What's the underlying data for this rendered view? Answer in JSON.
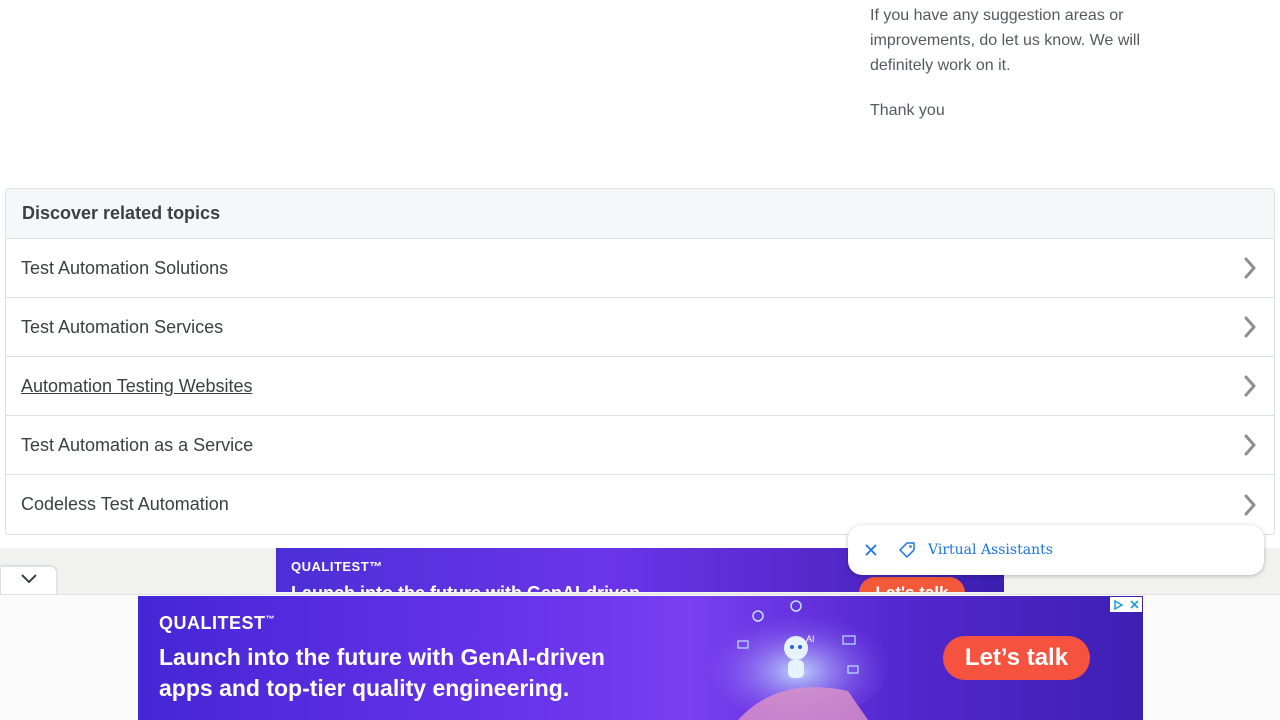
{
  "note": {
    "paragraph": "If you have any suggestion areas or improvements, do let us know. We will definitely work on it.",
    "thanks": "Thank you"
  },
  "related": {
    "title": "Discover related topics",
    "items": [
      {
        "label": "Test Automation Solutions"
      },
      {
        "label": "Test Automation Services"
      },
      {
        "label": "Automation Testing Websites"
      },
      {
        "label": "Test Automation as a Service"
      },
      {
        "label": "Codeless Test Automation"
      }
    ]
  },
  "inline_ad": {
    "brand": "QUALITEST™",
    "headline": "Launch into the future with GenAI-driven",
    "cta": "Let's talk"
  },
  "anchor_ad": {
    "brand": "QUALITEST",
    "brand_mark": "™",
    "line1": "Launch into the future with GenAI-driven",
    "line2": "apps and top-tier quality engineering.",
    "cta": "Let’s talk"
  },
  "tag_pill": {
    "label": "Virtual Assistants"
  },
  "icons": {
    "chevron": "chevron-right-icon",
    "collapse": "chevron-down-icon",
    "close": "close-icon",
    "tag": "tag-icon",
    "adchoices": "adchoices-icon"
  },
  "colors": {
    "ad_purple": "#5a2ad0",
    "cta_orange": "#f5533f",
    "link_blue": "#1a73e8"
  }
}
